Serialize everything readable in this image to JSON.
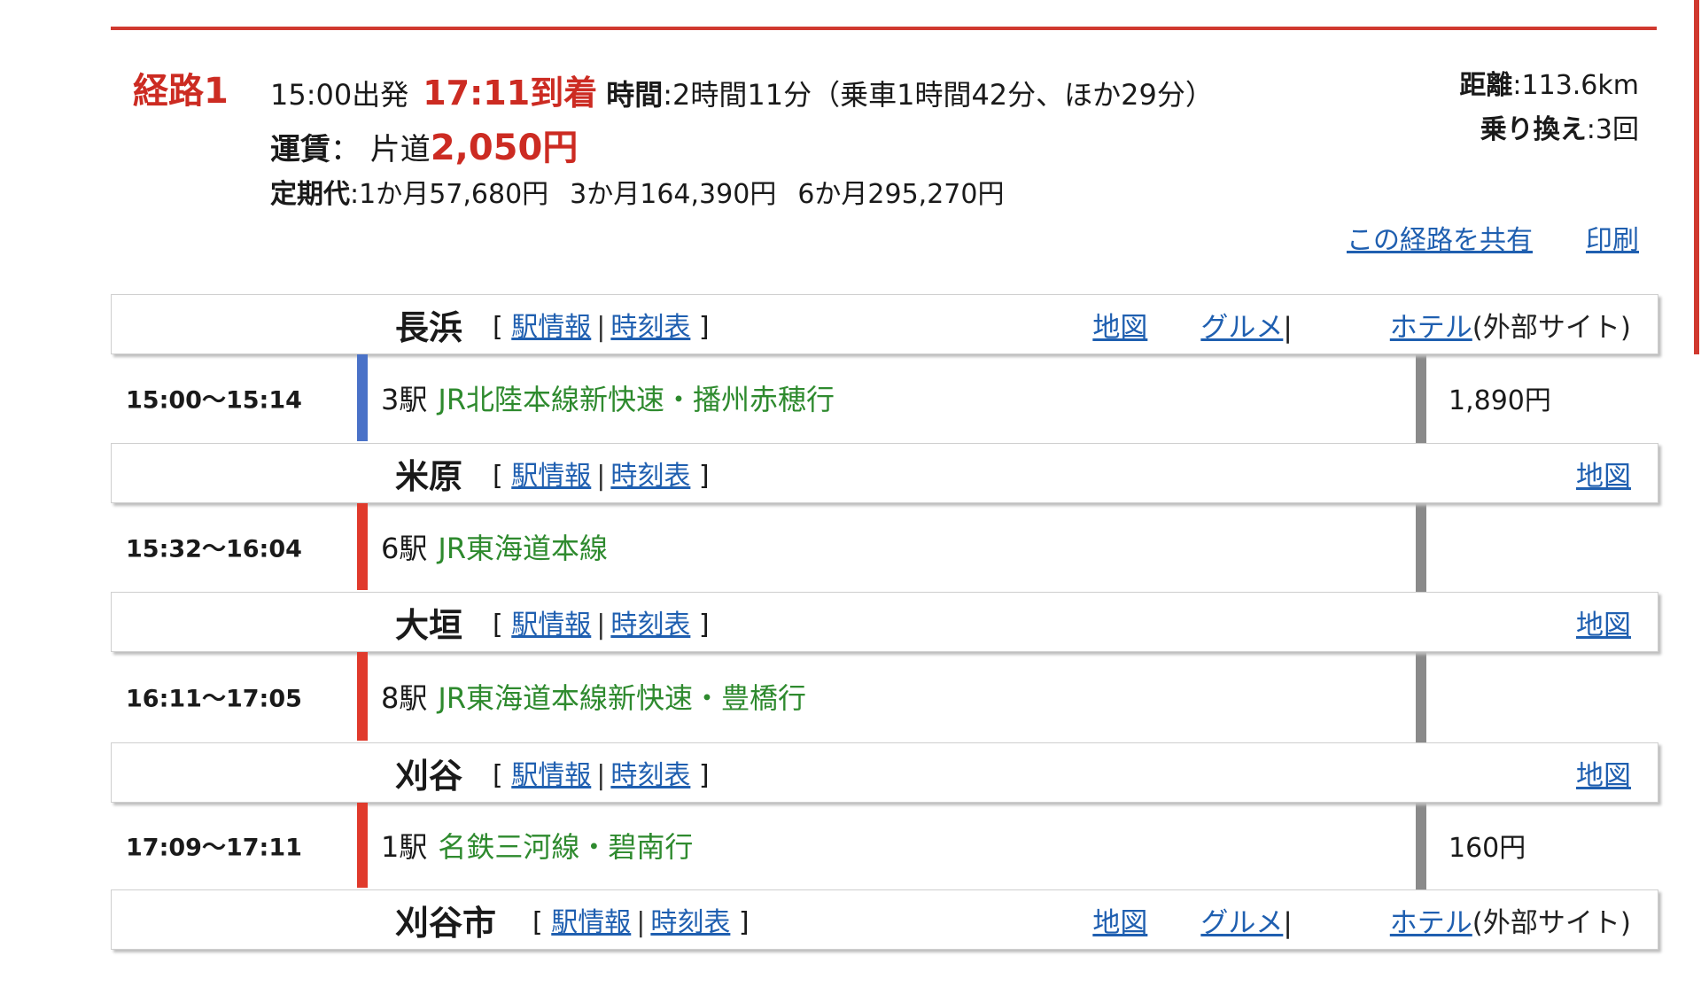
{
  "summary": {
    "route_label": "経路1",
    "departure": "15:00出発",
    "arrival": "17:11到着",
    "time_label": "時間",
    "time_value": ":2時間11分（乗車1時間42分、ほか29分）",
    "fare_label": "運賃",
    "fare_prefix": "： 片道",
    "fare_value": "2,050円",
    "pass_label": "定期代",
    "pass_1m": ":1か月57,680円",
    "pass_3m": "3か月164,390円",
    "pass_6m": "6か月295,270円",
    "distance_label": "距離",
    "distance_value": ":113.6km",
    "transfers_label": "乗り換え",
    "transfers_value": ":3回",
    "share_link": "この経路を共有",
    "print_link": "印刷"
  },
  "common": {
    "bracket_open": "[",
    "bracket_close": "]",
    "sep": "|",
    "station_info": "駅情報",
    "timetable": "時刻表",
    "map": "地図",
    "gourmet": "グルメ",
    "hotel": "ホテル",
    "external": "(外部サイト)"
  },
  "stations": [
    {
      "name": "長浜"
    },
    {
      "name": "米原"
    },
    {
      "name": "大垣"
    },
    {
      "name": "刈谷"
    },
    {
      "name": "刈谷市"
    }
  ],
  "segments": [
    {
      "time": "15:00〜15:14",
      "stops": "3駅",
      "line": "JR北陸本線新快速・播州赤穂行",
      "fare": "1,890円",
      "bar_color": "#4a72c8"
    },
    {
      "time": "15:32〜16:04",
      "stops": "6駅",
      "line": "JR東海道本線",
      "fare": "",
      "bar_color": "#e03a2c"
    },
    {
      "time": "16:11〜17:05",
      "stops": "8駅",
      "line": "JR東海道本線新快速・豊橋行",
      "fare": "",
      "bar_color": "#e03a2c"
    },
    {
      "time": "17:09〜17:11",
      "stops": "1駅",
      "line": "名鉄三河線・碧南行",
      "fare": "160円",
      "bar_color": "#e03a2c"
    }
  ]
}
